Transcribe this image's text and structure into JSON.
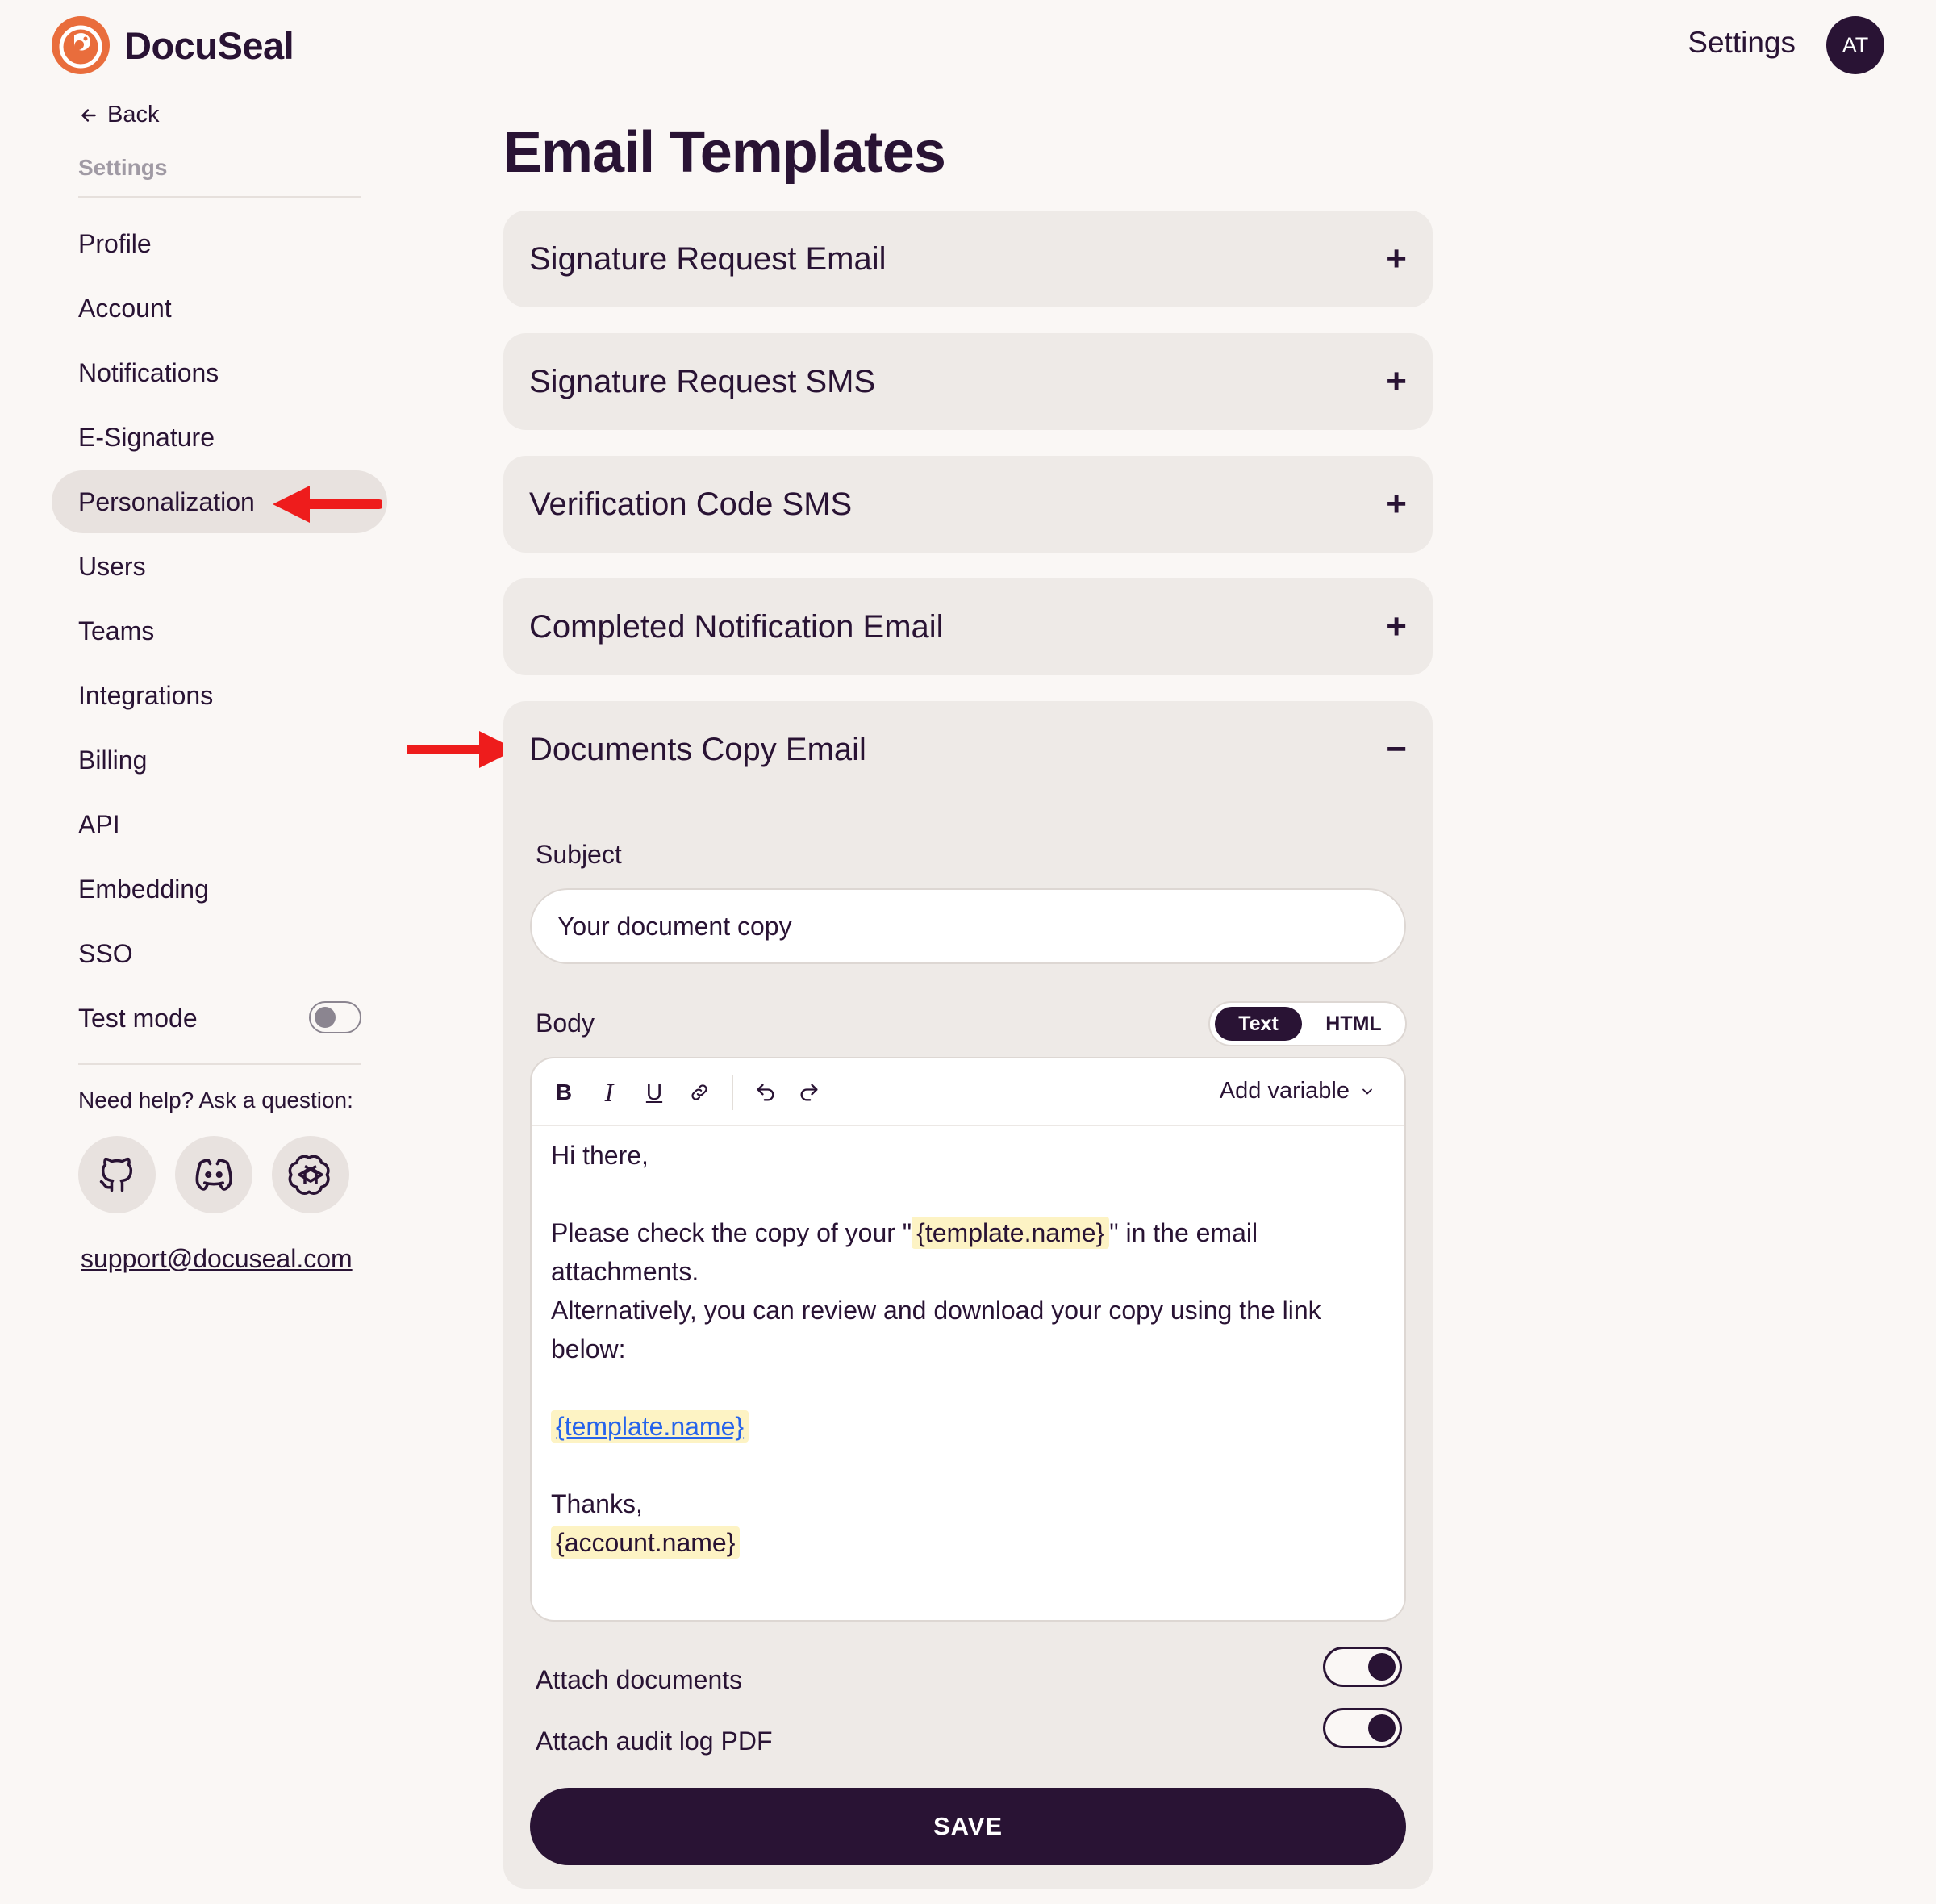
{
  "brand": {
    "name": "DocuSeal",
    "accent": "#e96d3c",
    "primary": "#291334"
  },
  "header": {
    "settings_label": "Settings",
    "avatar_initials": "AT"
  },
  "sidebar": {
    "back_label": "Back",
    "title": "Settings",
    "items": [
      {
        "label": "Profile"
      },
      {
        "label": "Account"
      },
      {
        "label": "Notifications"
      },
      {
        "label": "E-Signature"
      },
      {
        "label": "Personalization",
        "active": true
      },
      {
        "label": "Users"
      },
      {
        "label": "Teams"
      },
      {
        "label": "Integrations"
      },
      {
        "label": "Billing"
      },
      {
        "label": "API"
      },
      {
        "label": "Embedding"
      },
      {
        "label": "SSO"
      }
    ],
    "test_mode_label": "Test mode",
    "test_mode_enabled": false,
    "help_text": "Need help? Ask a question:",
    "social_icons": [
      "github-icon",
      "discord-icon",
      "openai-icon"
    ],
    "support_email": "support@docuseal.com"
  },
  "main": {
    "title": "Email Templates",
    "accordions": [
      {
        "title": "Signature Request Email",
        "expanded": false,
        "sign": "+"
      },
      {
        "title": "Signature Request SMS",
        "expanded": false,
        "sign": "+"
      },
      {
        "title": "Verification Code SMS",
        "expanded": false,
        "sign": "+"
      },
      {
        "title": "Completed Notification Email",
        "expanded": false,
        "sign": "+"
      },
      {
        "title": "Documents Copy Email",
        "expanded": true,
        "sign": "−"
      }
    ],
    "form": {
      "subject_label": "Subject",
      "subject_value": "Your document copy",
      "body_label": "Body",
      "mode_text": "Text",
      "mode_html": "HTML",
      "mode_selected": "Text",
      "add_variable_label": "Add variable",
      "body": {
        "greeting": "Hi there,",
        "line1_prefix": "Please check the copy of your \"",
        "line1_var": "{template.name}",
        "line1_suffix": "\" in the email attachments.",
        "line2": "Alternatively, you can review and download your copy using the link below:",
        "link_var": "{template.name}",
        "thanks": "Thanks,",
        "sign_var": "{account.name}"
      },
      "attach_documents_label": "Attach documents",
      "attach_documents_enabled": true,
      "attach_audit_label": "Attach audit log PDF",
      "attach_audit_enabled": true,
      "save_label": "SAVE"
    }
  }
}
